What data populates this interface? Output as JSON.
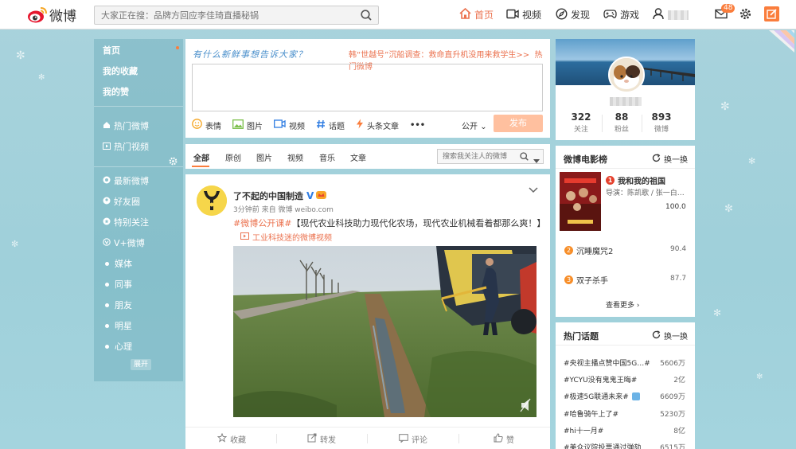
{
  "header": {
    "logo_text": "微博",
    "search_placeholder": "大家正在搜：品牌方回应李佳琦直播秘锅",
    "nav": [
      {
        "label": "首页",
        "active": true
      },
      {
        "label": "视频"
      },
      {
        "label": "发现"
      },
      {
        "label": "游戏"
      }
    ],
    "message_badge": "48",
    "colors": {
      "accent": "#eb7350",
      "badge": "#fa7d3c"
    }
  },
  "sidebar": {
    "items": [
      {
        "label": "首页"
      },
      {
        "label": "我的收藏"
      },
      {
        "label": "我的赞"
      },
      {
        "label": "热门微博"
      },
      {
        "label": "热门视频"
      },
      {
        "label": "最新微博"
      },
      {
        "label": "好友圈"
      },
      {
        "label": "特别关注"
      },
      {
        "label": "V+微博"
      },
      {
        "label": "媒体"
      },
      {
        "label": "同事"
      },
      {
        "label": "朋友"
      },
      {
        "label": "明星"
      },
      {
        "label": "心理"
      }
    ],
    "expand_label": "展开"
  },
  "publisher": {
    "prompt": "有什么新鲜事想告诉大家？",
    "hot_text": "韩“世越号”沉船调查：救命直升机没用来救学生>>",
    "hot_link": "热门微博",
    "tools": [
      "表情",
      "图片",
      "视频",
      "话题",
      "头条文章",
      "•••"
    ],
    "visibility": "公开",
    "submit_label": "发布"
  },
  "filter_tabs": {
    "tabs": [
      "全部",
      "原创",
      "图片",
      "视频",
      "音乐",
      "文章"
    ],
    "search_placeholder": "搜索我关注人的微博"
  },
  "post": {
    "author": "了不起的中国制造",
    "meta": "3分钟前 来自 微博 weibo.com",
    "tag": "#微博公开课#",
    "text": "【现代农业科技助力现代化农场，现代农业机械看着都那么爽！】",
    "video_link": "工业科技迷的微博视频",
    "actions": [
      "收藏",
      "转发",
      "评论",
      "赞"
    ]
  },
  "profile": {
    "stats": [
      {
        "value": "322",
        "label": "关注"
      },
      {
        "value": "88",
        "label": "粉丝"
      },
      {
        "value": "893",
        "label": "微博"
      }
    ]
  },
  "movies": {
    "title": "微博电影榜",
    "refresh_label": "换一换",
    "top": {
      "rank": "1",
      "name": "我和我的祖国",
      "sub": "导演：陈凯歌 / 张一白…",
      "score": "100.0"
    },
    "list": [
      {
        "rank": "2",
        "name": "沉睡魔咒2",
        "score": "90.4"
      },
      {
        "rank": "3",
        "name": "双子杀手",
        "score": "87.7"
      }
    ],
    "more_label": "查看更多 ›"
  },
  "topics": {
    "title": "热门话题",
    "refresh_label": "换一换",
    "items": [
      {
        "name": "#央视主播点赞中国5G…#",
        "count": "5606万"
      },
      {
        "name": "#YCYU没有鬼鬼王晦#",
        "count": "2亿"
      },
      {
        "name": "#极速5G联通未来#",
        "count": "6609万"
      },
      {
        "name": "#哈鲁骑午上了#",
        "count": "5230万"
      },
      {
        "name": "#hi十一月#",
        "count": "8亿"
      },
      {
        "name": "#美众议院投票通过弹劾",
        "count": "6515万"
      }
    ]
  }
}
